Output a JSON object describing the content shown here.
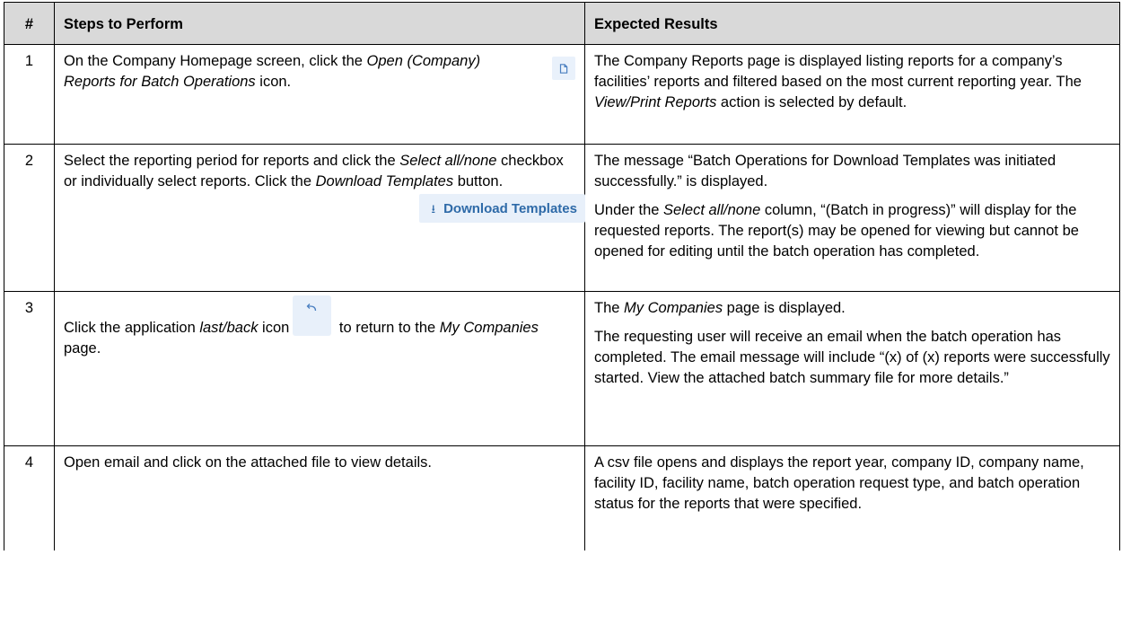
{
  "table": {
    "headers": {
      "num": "#",
      "steps": "Steps to Perform",
      "results": "Expected Results"
    },
    "rows": [
      {
        "num": "1",
        "step": {
          "t1": "On the Company Homepage screen, click the ",
          "em1": "Open (Company) Reports for Batch Operations",
          "t2": " icon.",
          "icon": "document-icon"
        },
        "result": {
          "t1": "The Company Reports page is displayed listing reports for a company’s facilities’ reports and filtered based on the most current reporting year. The ",
          "em1": "View/Print Reports",
          "t2": " action is selected by default."
        }
      },
      {
        "num": "2",
        "step": {
          "t1": "Select the reporting period for reports and click the ",
          "em1": "Select all/none",
          "t2": " checkbox or individually select reports. Click the ",
          "em2": "Download Templates",
          "t3": " button.",
          "button_icon": "download-icon",
          "button_label": "Download Templates"
        },
        "result": {
          "p1": "The message “Batch Operations for Download Templates was initiated successfully.” is displayed.",
          "p2_t1": "Under the ",
          "p2_em1": "Select all/none",
          "p2_t2": " column, “(Batch in progress)” will display for the requested reports. The report(s) may be opened for viewing but cannot be opened for editing until the batch operation has completed."
        }
      },
      {
        "num": "3",
        "step": {
          "t1": "Click the application ",
          "em1": "last/back",
          "t2": " icon",
          "t3": " to return to the ",
          "em2": "My Companies",
          "t4": " page.",
          "icon": "back-arrow-icon"
        },
        "result": {
          "p1_em1": "My Companies",
          "p1_pre": "The ",
          "p1_post": " page is displayed.",
          "p2": "The requesting user will receive an email when the batch operation has completed. The email message will include “(x) of (x) reports were successfully started. View the attached batch summary file for more details.”"
        }
      },
      {
        "num": "4",
        "step": {
          "t1": "Open email and click on the attached file to view details."
        },
        "result": {
          "t1": "A csv file opens and displays the report year, company ID, company name, facility ID, facility name, batch operation request type, and batch operation status for the reports that were specified."
        }
      }
    ]
  },
  "colors": {
    "header_bg": "#d9d9d9",
    "icon_button_bg": "#e8f0fa",
    "icon_color": "#2e6aa8"
  }
}
